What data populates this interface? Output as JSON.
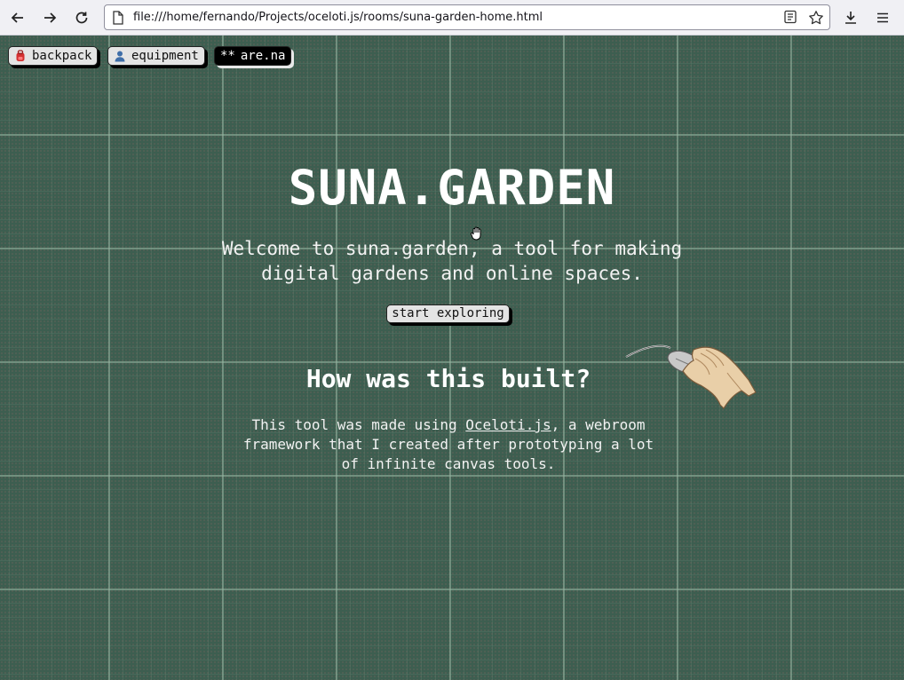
{
  "browser": {
    "url": "file:///home/fernando/Projects/oceloti.js/rooms/suna-garden-home.html"
  },
  "toolbar": {
    "chips": [
      {
        "icon": "backpack-icon",
        "label": "backpack"
      },
      {
        "icon": "person-icon",
        "label": "equipment"
      },
      {
        "icon": "arena-icon",
        "label": "are.na",
        "prefix": "**"
      }
    ]
  },
  "hero": {
    "title": "SUNA.GARDEN",
    "welcome": "Welcome to suna.garden, a tool for making digital gardens and online spaces.",
    "cta_label": "start exploring"
  },
  "about": {
    "heading": "How was this built?",
    "text_before": "This tool was made using ",
    "link_text": "Oceloti.js",
    "text_after": ", a webroom framework that I created after prototyping a lot of infinite canvas tools."
  },
  "colors": {
    "background": "#3d5e50",
    "grid": "#96b4a0",
    "text": "#ffffff",
    "chip": "#e4e4e4"
  }
}
